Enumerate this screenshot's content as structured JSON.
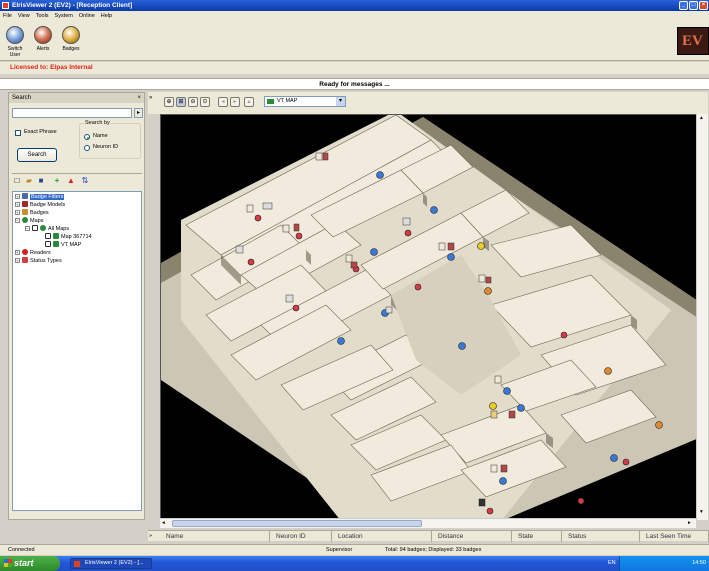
{
  "window": {
    "title": "ElrisViewer 2 (EV2) - [Reception Client]"
  },
  "menu": [
    "File",
    "View",
    "Tools",
    "System",
    "Online",
    "Help"
  ],
  "toolbar": {
    "switch_user": "Switch User",
    "alerts": "Alerts",
    "badges": "Badges",
    "logo_text": "EV"
  },
  "license_text": "Licensed to: Elpas Internal",
  "ready_text": "Ready for messages ...",
  "search": {
    "header": "Search",
    "close": "×",
    "value": "",
    "go_label": "▸",
    "exact_phrase": "Exact Phrase",
    "search_by": "Search by",
    "option_name": "Name",
    "option_neuron": "Neuron ID",
    "button": "Search"
  },
  "tree": [
    {
      "label": "Badge Filters",
      "selected": true
    },
    {
      "label": "Badge Models"
    },
    {
      "label": "Badges"
    },
    {
      "label": "Maps"
    },
    {
      "label": "All Maps"
    },
    {
      "label": "Map 367714"
    },
    {
      "label": "VT MAP"
    },
    {
      "label": "Readers"
    },
    {
      "label": "Status Types"
    }
  ],
  "map": {
    "selected_map": "VT MAP",
    "dropdown": "▾"
  },
  "grid_headers": [
    "Name",
    "Neuron ID",
    "Location",
    "Distance",
    "State",
    "Status",
    "Last Seen Time"
  ],
  "status": {
    "left": "Connected",
    "role": "Supervisor",
    "totals": "Total: 94 badges; Displayed: 33 badges"
  },
  "taskbar": {
    "start": "start",
    "task": "ElrisViewer 2 (EV2) - [...",
    "lang": "EN",
    "clock": "14:50"
  },
  "colors": {
    "titlebar": "#1848c0",
    "license": "#e02010",
    "marker_blue": "#3a78d8",
    "marker_red": "#d83848",
    "marker_orange": "#e08a30",
    "marker_yellow": "#e8d020"
  }
}
